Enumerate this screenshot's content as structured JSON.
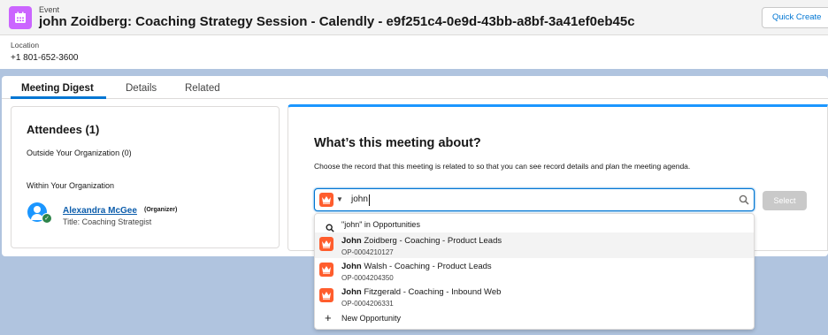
{
  "header": {
    "label": "Event",
    "title": "john Zoidberg: Coaching Strategy Session - Calendly - e9f251c4-0e9d-43bb-a8bf-3a41ef0eb45c",
    "quick_create": "Quick Create"
  },
  "location": {
    "label": "Location",
    "value": "+1 801-652-3600"
  },
  "tabs": [
    {
      "label": "Meeting Digest",
      "active": true
    },
    {
      "label": "Details",
      "active": false
    },
    {
      "label": "Related",
      "active": false
    }
  ],
  "attendees": {
    "title": "Attendees (1)",
    "outside": "Outside Your Organization (0)",
    "within": "Within Your Organization",
    "person": {
      "name": "Alexandra McGee",
      "organizer": "(Organizer)",
      "title": "Title: Coaching Strategist"
    }
  },
  "meeting": {
    "title": "What’s this meeting about?",
    "description": "Choose the record that this meeting is related to so that you can see record details and plan the meeting agenda.",
    "search_value": "john",
    "select_label": "Select"
  },
  "dropdown": {
    "search_label": "\"john\" in Opportunities",
    "results": [
      {
        "match": "John",
        "rest": " Zoidberg - Coaching - Product Leads",
        "id": "OP-0004210127"
      },
      {
        "match": "John",
        "rest": " Walsh - Coaching - Product Leads",
        "id": "OP-0004204350"
      },
      {
        "match": "John",
        "rest": " Fitzgerald - Coaching - Inbound Web",
        "id": "OP-0004206331"
      }
    ],
    "new_label": "New Opportunity"
  },
  "icons": {
    "event": "calendar-icon",
    "opportunity": "crown-icon",
    "search": "search-icon",
    "add": "plus-icon"
  },
  "colors": {
    "event_icon": "#cb65ff",
    "opportunity_icon": "#ff5d2d",
    "accent": "#0176d3",
    "background": "#b0c4df"
  }
}
